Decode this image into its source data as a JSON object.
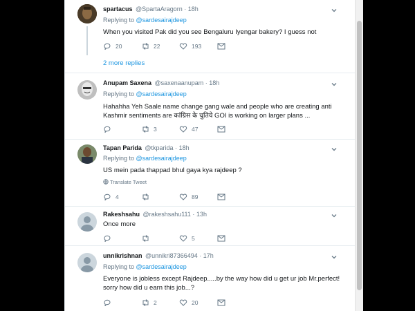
{
  "tweets": [
    {
      "name": "spartacus",
      "handle": "@SpartaAragorn",
      "time": "18h",
      "replying_label": "Replying to",
      "replying_to": "@sardesairajdeep",
      "text": "When you visited Pak did you see Bengaluru Iyengar bakery? I guess not",
      "replies": "20",
      "retweets": "22",
      "likes": "193"
    },
    {
      "name": "Anupam Saxena",
      "handle": "@saxenaanupam",
      "time": "18h",
      "replying_label": "Replying to",
      "replying_to": "@sardesairajdeep",
      "text": "Hahahha Yeh Saale name change gang wale and people who are creating anti Kashmir sentiments are  कांग्रिस के चुतिये GOI is working on larger plans ...",
      "replies": "",
      "retweets": "3",
      "likes": "47"
    },
    {
      "name": "Tapan Parida",
      "handle": "@tkparida",
      "time": "18h",
      "replying_label": "Replying to",
      "replying_to": "@sardesairajdeep",
      "text": "US mein pada thappad bhul gaya kya rajdeep ?",
      "translate": "Translate Tweet",
      "replies": "4",
      "retweets": "",
      "likes": "89"
    },
    {
      "name": "Rakeshsahu",
      "handle": "@rakeshsahu111",
      "time": "13h",
      "text": "Once more",
      "replies": "",
      "retweets": "",
      "likes": "5"
    },
    {
      "name": "unnikrishnan",
      "handle": "@unnikri87366494",
      "time": "17h",
      "replying_label": "Replying to",
      "replying_to": "@sardesairajdeep",
      "text": "Everyone is jobless except Rajdeep.....by the way how did u get ur job Mr.perfect! sorry how did u earn this job...?",
      "replies": "",
      "retweets": "2",
      "likes": "20"
    }
  ],
  "more_replies": "2 more replies",
  "colors": {
    "link": "#1b95e0",
    "muted": "#657786",
    "text": "#14171a"
  }
}
